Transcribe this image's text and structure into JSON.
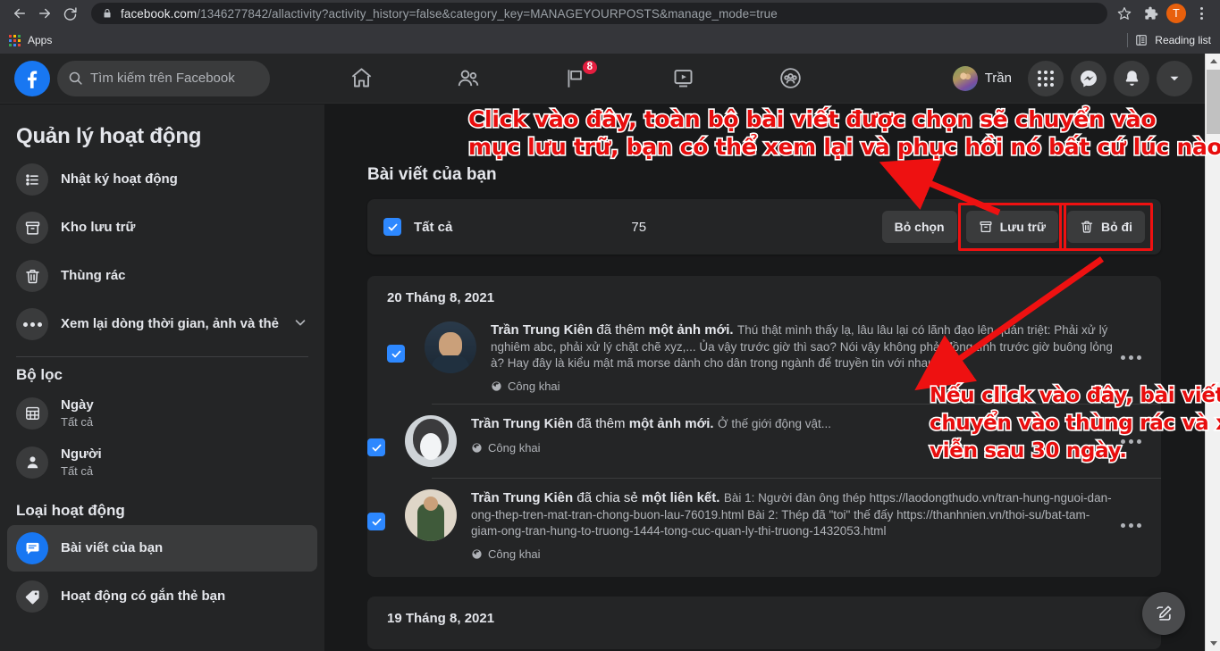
{
  "browser": {
    "url_domain": "facebook.com",
    "url_path": "/1346277842/allactivity?activity_history=false&category_key=MANAGEYOURPOSTS&manage_mode=true",
    "back_icon": "back-arrow-icon",
    "forward_icon": "forward-arrow-icon",
    "reload_icon": "reload-icon",
    "lock_icon": "lock-icon",
    "star_icon": "bookmark-star-icon",
    "extensions_icon": "extensions-puzzle-icon",
    "profile_initial": "T",
    "menu_icon": "three-dot-menu-icon",
    "bookmarks": {
      "apps_label": "Apps",
      "reading_list_label": "Reading list"
    }
  },
  "facebook": {
    "logo_icon": "facebook-logo-icon",
    "search": {
      "placeholder": "Tìm kiếm trên Facebook",
      "value": "",
      "icon": "search-icon"
    },
    "nav": [
      {
        "name": "home",
        "icon": "home-icon",
        "badge": ""
      },
      {
        "name": "friends",
        "icon": "friends-icon",
        "badge": ""
      },
      {
        "name": "pages",
        "icon": "flag-page-icon",
        "badge": "8"
      },
      {
        "name": "watch",
        "icon": "video-watch-icon",
        "badge": ""
      },
      {
        "name": "groups",
        "icon": "groups-icon",
        "badge": ""
      }
    ],
    "profile_name": "Trần",
    "right_buttons": [
      {
        "name": "menu-grid",
        "icon": "grid-apps-icon"
      },
      {
        "name": "messenger",
        "icon": "messenger-icon"
      },
      {
        "name": "notifications",
        "icon": "bell-icon"
      },
      {
        "name": "account",
        "icon": "chevron-down-icon"
      }
    ]
  },
  "sidebar": {
    "title": "Quản lý hoạt động",
    "items": [
      {
        "label": "Nhật ký hoạt động",
        "icon": "list-icon"
      },
      {
        "label": "Kho lưu trữ",
        "icon": "archive-box-icon"
      },
      {
        "label": "Thùng rác",
        "icon": "trash-icon"
      },
      {
        "label": "Xem lại dòng thời gian, ảnh và thẻ",
        "icon": "ellipsis-icon",
        "chevron": true
      }
    ],
    "filter_heading": "Bộ lọc",
    "filters": [
      {
        "label": "Ngày",
        "value": "Tất cả",
        "icon": "calendar-icon"
      },
      {
        "label": "Người",
        "value": "Tất cả",
        "icon": "person-icon"
      }
    ],
    "activity_heading": "Loại hoạt động",
    "activities": [
      {
        "label": "Bài viết của bạn",
        "icon": "posts-icon",
        "active": true
      },
      {
        "label": "Hoạt động có gắn thẻ bạn",
        "icon": "tag-icon",
        "active": false
      }
    ]
  },
  "main": {
    "title": "Bài viết của bạn",
    "selection": {
      "select_all_label": "Tất cả",
      "count": "75",
      "deselect_label": "Bỏ chọn",
      "archive_label": "Lưu trữ",
      "archive_icon": "archive-box-icon",
      "delete_label": "Bỏ đi",
      "delete_icon": "trash-icon",
      "more_icon": "three-dot-more-icon"
    },
    "groups": [
      {
        "date": "20 Tháng 8, 2021",
        "posts": [
          {
            "author": "Trần Trung Kiên",
            "action": " đã thêm ",
            "object": "một ảnh mới.",
            "text": "Thú thật mình thấy lạ, lâu lâu lại có lãnh đạo lên quán triệt: Phải xử lý nghiêm abc, phải xử lý chặt chẽ xyz,... Ủa vậy trước giờ thì sao? Nói vậy không phải đồng tình trước giờ buông lỏng à? Hay đây là kiểu mật mã morse dành cho dân trong ngành để truyền tin với nhau???",
            "privacy": "Công khai",
            "privacy_icon": "globe-icon",
            "thumb": "photo-thumbnail-portrait"
          },
          {
            "author": "Trần Trung Kiên",
            "action": " đã thêm ",
            "object": "một ảnh mới.",
            "text": "Ở thế giới động vật...",
            "privacy": "Công khai",
            "privacy_icon": "globe-icon",
            "thumb": "photo-thumbnail-husky"
          },
          {
            "author": "Trần Trung Kiên",
            "action": " đã chia sẻ ",
            "object": "một liên kết.",
            "text": "Bài 1: Người đàn ông thép https://laodongthudo.vn/tran-hung-nguoi-dan-ong-thep-tren-mat-tran-chong-buon-lau-76019.html Bài 2: Thép đã \"toi\" thế đấy https://thanhnien.vn/thoi-su/bat-tam-giam-ong-tran-hung-to-truong-1444-tong-cuc-quan-ly-thi-truong-1432053.html",
            "privacy": "Công khai",
            "privacy_icon": "globe-icon",
            "thumb": "photo-thumbnail-group"
          }
        ]
      },
      {
        "date": "19 Tháng 8, 2021",
        "posts": []
      }
    ],
    "fab_icon": "compose-pencil-icon"
  },
  "annotations": [
    {
      "id": "archive-annotation",
      "line1": "Click vào đây, toàn bộ bài viết được chọn sẽ chuyển vào",
      "line2": "mục lưu trữ, bạn có thể xem lại và phục hồi nó bất cứ lúc nào.",
      "color": "#e80d0d"
    },
    {
      "id": "delete-annotation",
      "line1": "Nếu click vào đây, bài viết sẽ được",
      "line2": "chuyển vào thùng rác và xóa vĩnh",
      "line3": "viễn sau 30 ngày.",
      "color": "#e80d0d"
    }
  ]
}
